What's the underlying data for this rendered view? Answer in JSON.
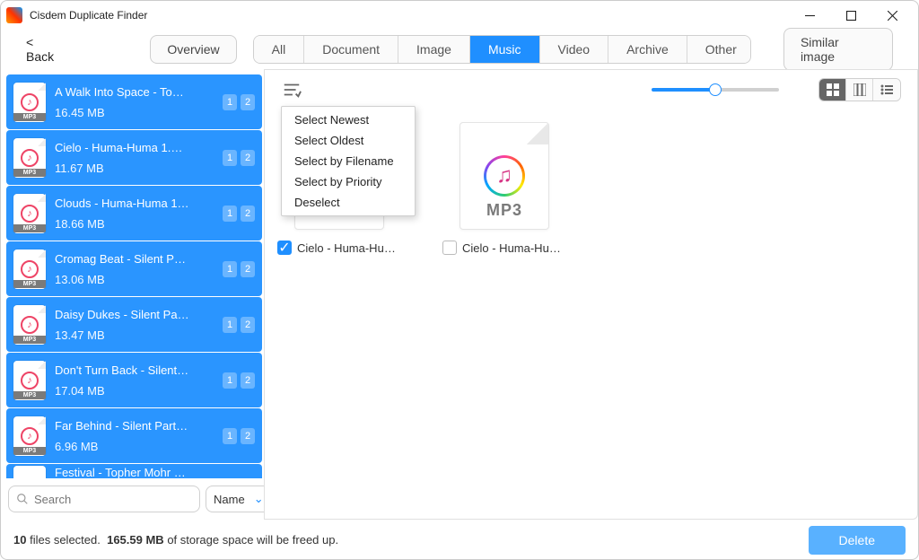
{
  "titlebar": {
    "title": "Cisdem Duplicate Finder"
  },
  "toolbar": {
    "back": "< Back",
    "overview": "Overview",
    "tabs": [
      "All",
      "Document",
      "Image",
      "Music",
      "Video",
      "Archive",
      "Other"
    ],
    "active_tab_index": 3,
    "similar": "Similar image"
  },
  "sidebar": {
    "items": [
      {
        "name": "A Walk Into Space - Toph...",
        "size": "16.45 MB",
        "badges": [
          "1",
          "2"
        ]
      },
      {
        "name": "Cielo - Huma-Huma 1.m...",
        "size": "11.67 MB",
        "badges": [
          "1",
          "2"
        ]
      },
      {
        "name": "Clouds - Huma-Huma 1....",
        "size": "18.66 MB",
        "badges": [
          "1",
          "2"
        ]
      },
      {
        "name": "Cromag Beat - Silent Part...",
        "size": "13.06 MB",
        "badges": [
          "1",
          "2"
        ]
      },
      {
        "name": "Daisy Dukes - Silent Partn...",
        "size": "13.47 MB",
        "badges": [
          "1",
          "2"
        ]
      },
      {
        "name": "Don't Turn Back - Silent ...",
        "size": "17.04 MB",
        "badges": [
          "1",
          "2"
        ]
      },
      {
        "name": "Far Behind - Silent Partne...",
        "size": "6.96 MB",
        "badges": [
          "1",
          "2"
        ]
      },
      {
        "name": "Festival - Topher Mohr a...",
        "size": "",
        "badges": []
      }
    ],
    "search_placeholder": "Search",
    "sort_label": "Name"
  },
  "main": {
    "context_menu": [
      "Select Newest",
      "Select Oldest",
      "Select by Filename",
      "Select by Priority",
      "Deselect"
    ],
    "cells": [
      {
        "label": "Cielo - Huma-Huma...",
        "checked": true,
        "ext": "MP3"
      },
      {
        "label": "Cielo - Huma-Huma...",
        "checked": false,
        "ext": "MP3"
      }
    ],
    "slider_value": 50
  },
  "footer": {
    "count": "10",
    "sel_text": "files selected.",
    "size": "165.59 MB",
    "free_text": "of storage space will be freed up.",
    "delete": "Delete"
  }
}
